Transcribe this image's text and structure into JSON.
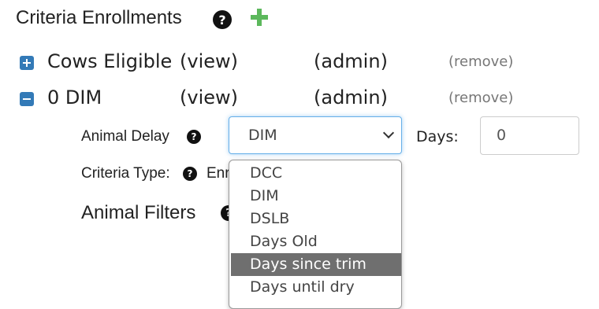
{
  "header": {
    "title": "Criteria Enrollments"
  },
  "rows": [
    {
      "name": "Cows Eligible",
      "view": "(view)",
      "admin": "(admin)",
      "remove": "(remove)"
    },
    {
      "name": "0 DIM",
      "view": "(view)",
      "admin": "(admin)",
      "remove": "(remove)"
    }
  ],
  "details": {
    "animal_delay_label": "Animal Delay",
    "animal_delay_value": "DIM",
    "days_label": "Days:",
    "days_value": "0",
    "criteria_type_label": "Criteria Type:",
    "criteria_type_value_partial": "Enr",
    "animal_filters_label": "Animal Filters"
  },
  "dropdown": {
    "options": [
      "DCC",
      "DIM",
      "DSLB",
      "Days Old",
      "Days since trim",
      "Days until dry"
    ],
    "highlighted": "Days since trim"
  },
  "colors": {
    "accent_blue": "#337ab7",
    "add_green": "#5cb85c",
    "highlight_gray": "#6f6f6f"
  }
}
